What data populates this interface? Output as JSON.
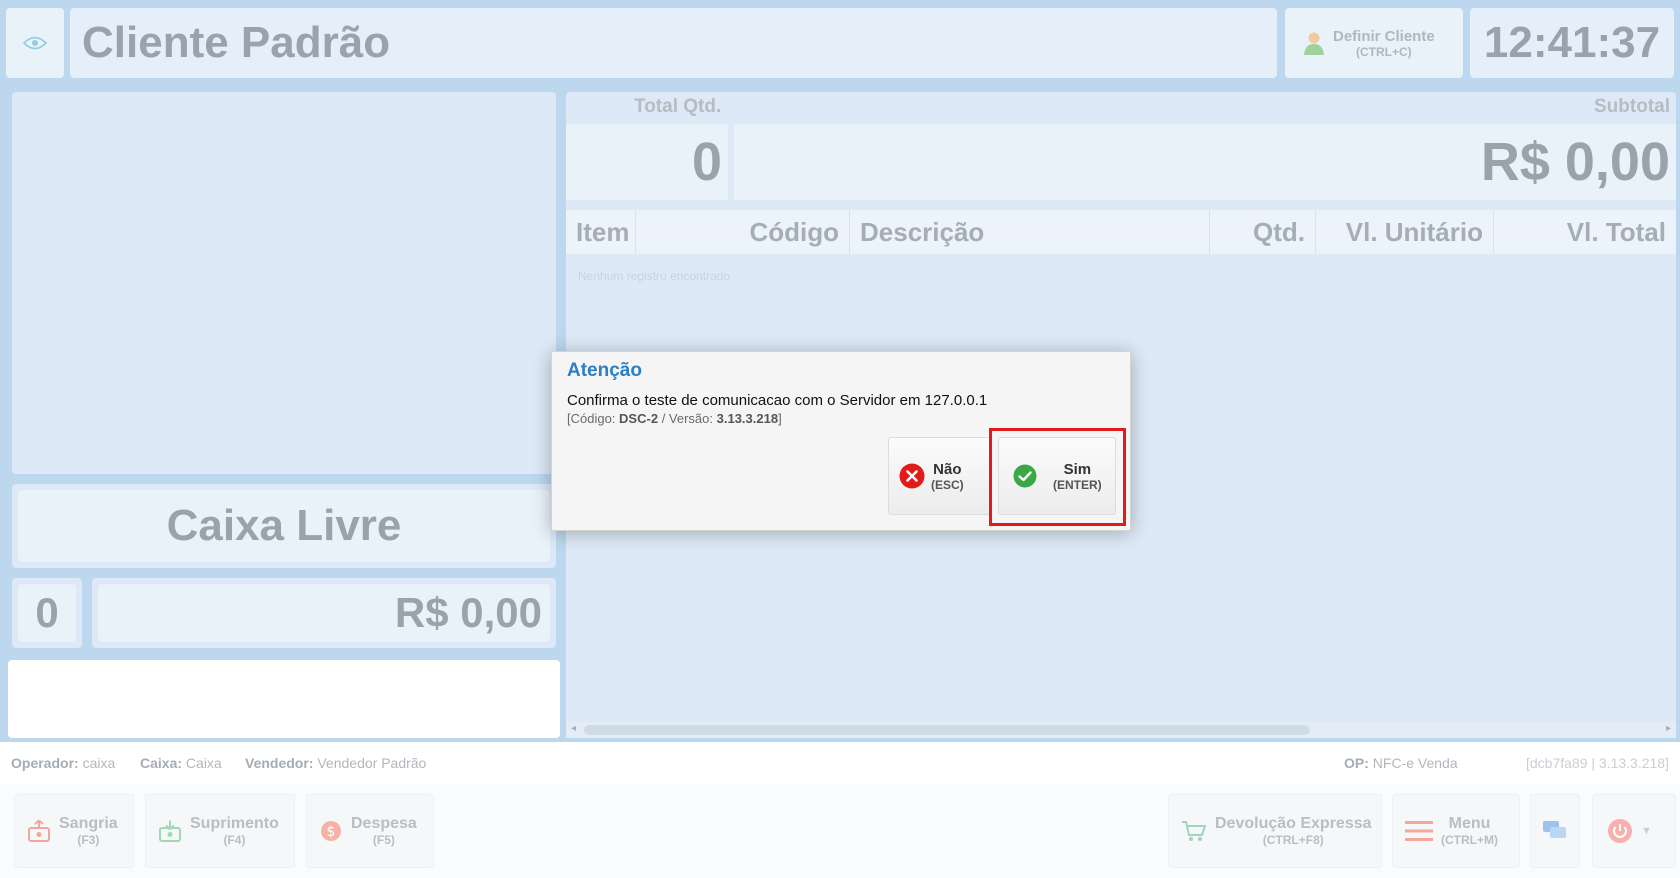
{
  "header": {
    "client_name": "Cliente Padrão",
    "define_client_label": "Definir Cliente",
    "define_client_shortcut": "(CTRL+C)",
    "clock": "12:41:37"
  },
  "left_panel": {
    "status": "Caixa Livre",
    "item_count": "0",
    "amount": "R$ 0,00"
  },
  "summary": {
    "total_qtd_label": "Total Qtd.",
    "total_qtd_value": "0",
    "subtotal_label": "Subtotal",
    "subtotal_value": "R$ 0,00"
  },
  "table": {
    "columns": [
      "Item",
      "Código",
      "Descrição",
      "Qtd.",
      "Vl. Unitário",
      "Vl. Total"
    ],
    "empty_message": "Nenhum registro encontrado"
  },
  "status_bar": {
    "operador_label": "Operador:",
    "operador_value": "caixa",
    "caixa_label": "Caixa:",
    "caixa_value": "Caixa",
    "vendedor_label": "Vendedor:",
    "vendedor_value": "Vendedor Padrão",
    "op_label": "OP:",
    "op_value": "NFC-e Venda",
    "version": "[dcb7fa89 | 3.13.3.218]"
  },
  "toolbar": {
    "sangria_label": "Sangria",
    "sangria_shortcut": "(F3)",
    "suprimento_label": "Suprimento",
    "suprimento_shortcut": "(F4)",
    "despesa_label": "Despesa",
    "despesa_shortcut": "(F5)",
    "devolucao_label": "Devolução Expressa",
    "devolucao_shortcut": "(CTRL+F8)",
    "menu_label": "Menu",
    "menu_shortcut": "(CTRL+M)"
  },
  "dialog": {
    "title": "Atenção",
    "message": "Confirma o teste de comunicacao com o Servidor em 127.0.0.1",
    "code_label": "[Código:",
    "code_value": "DSC-2",
    "version_label": "/ Versão:",
    "version_value": "3.13.3.218",
    "code_close": "]",
    "no_label": "Não",
    "no_shortcut": "(ESC)",
    "yes_label": "Sim",
    "yes_shortcut": "(ENTER)"
  },
  "colors": {
    "background_blue": "#bcd7ee",
    "panel_blue": "#dde9f6",
    "dialog_title": "#2a7fc6",
    "cancel_red": "#e21a1a",
    "confirm_green": "#3aa845",
    "highlight_border": "#e21a1a"
  },
  "icons": [
    "eye-icon",
    "user-icon",
    "sangria-icon",
    "suprimento-icon",
    "despesa-icon",
    "cart-icon",
    "menu-icon",
    "chat-icon",
    "power-icon",
    "cancel-icon",
    "check-icon"
  ]
}
